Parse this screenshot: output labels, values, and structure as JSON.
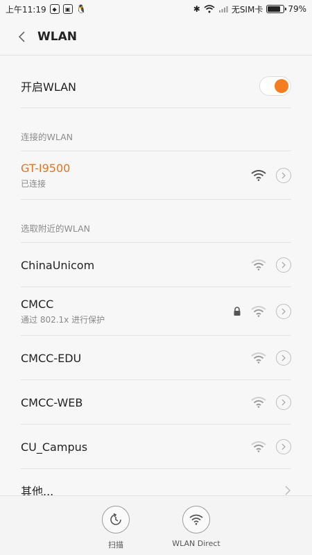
{
  "status_bar": {
    "time": "上午11:19",
    "carrier": "无SIM卡",
    "battery": "79%",
    "battery_level": 0.79
  },
  "header": {
    "title": "WLAN"
  },
  "wlan_toggle": {
    "label": "开启WLAN",
    "enabled": true
  },
  "connected_section": {
    "title": "连接的WLAN",
    "network": {
      "name": "GT-I9500",
      "status": "已连接"
    }
  },
  "nearby_section": {
    "title": "选取附近的WLAN",
    "networks": [
      {
        "name": "ChinaUnicom",
        "sub": "",
        "locked": false
      },
      {
        "name": "CMCC",
        "sub": "通过 802.1x 进行保护",
        "locked": true
      },
      {
        "name": "CMCC-EDU",
        "sub": "",
        "locked": false
      },
      {
        "name": "CMCC-WEB",
        "sub": "",
        "locked": false
      },
      {
        "name": "CU_Campus",
        "sub": "",
        "locked": false
      }
    ],
    "other": "其他..."
  },
  "bottom_actions": {
    "scan_label": "扫描",
    "direct_label": "WLAN Direct"
  },
  "colors": {
    "accent": "#f57c1f",
    "connected_text": "#e3741f"
  }
}
